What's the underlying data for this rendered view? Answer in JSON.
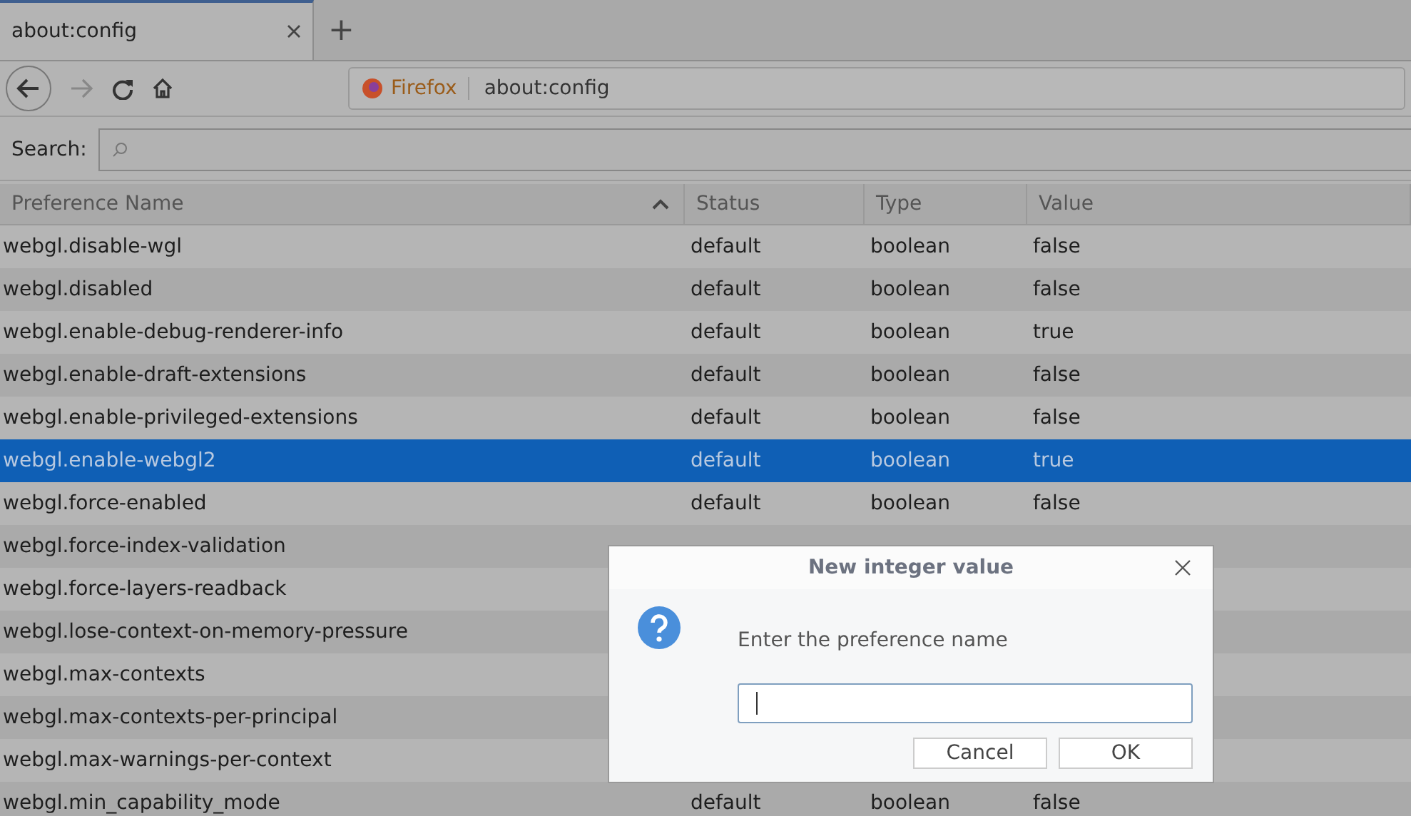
{
  "tabs": [
    {
      "label": "about:config",
      "selected": true
    }
  ],
  "new_tab": "+",
  "address_bar": {
    "identity": "Firefox",
    "url": "about:config"
  },
  "search": {
    "label": "Search:"
  },
  "table": {
    "columns": [
      "Preference Name",
      "Status",
      "Type",
      "Value"
    ],
    "rows": [
      {
        "name": "webgl.disable-wgl",
        "status": "default",
        "type": "boolean",
        "value": "false",
        "selected": false
      },
      {
        "name": "webgl.disabled",
        "status": "default",
        "type": "boolean",
        "value": "false",
        "selected": false
      },
      {
        "name": "webgl.enable-debug-renderer-info",
        "status": "default",
        "type": "boolean",
        "value": "true",
        "selected": false
      },
      {
        "name": "webgl.enable-draft-extensions",
        "status": "default",
        "type": "boolean",
        "value": "false",
        "selected": false
      },
      {
        "name": "webgl.enable-privileged-extensions",
        "status": "default",
        "type": "boolean",
        "value": "false",
        "selected": false
      },
      {
        "name": "webgl.enable-webgl2",
        "status": "default",
        "type": "boolean",
        "value": "true",
        "selected": true
      },
      {
        "name": "webgl.force-enabled",
        "status": "default",
        "type": "boolean",
        "value": "false",
        "selected": false
      },
      {
        "name": "webgl.force-index-validation",
        "selected": false
      },
      {
        "name": "webgl.force-layers-readback",
        "selected": false
      },
      {
        "name": "webgl.lose-context-on-memory-pressure",
        "selected": false
      },
      {
        "name": "webgl.max-contexts",
        "selected": false
      },
      {
        "name": "webgl.max-contexts-per-principal",
        "selected": false
      },
      {
        "name": "webgl.max-warnings-per-context",
        "selected": false
      },
      {
        "name": "webgl.min_capability_mode",
        "status": "default",
        "type": "boolean",
        "value": "false",
        "selected": false
      }
    ]
  },
  "dialog": {
    "title": "New integer value",
    "message": "Enter the preference name",
    "buttons": [
      "Cancel",
      "OK"
    ]
  }
}
